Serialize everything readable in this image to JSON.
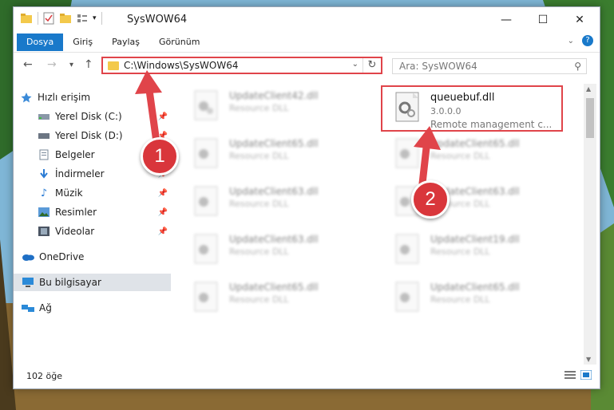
{
  "window": {
    "title": "SysWOW64",
    "controls": {
      "minimize": "—",
      "maximize": "☐",
      "close": "✕"
    }
  },
  "ribbon": {
    "tabs": [
      "Dosya",
      "Giriş",
      "Paylaş",
      "Görünüm"
    ],
    "help_label": "?"
  },
  "nav": {
    "back": "←",
    "forward": "→",
    "recent": "▾",
    "up": "↑",
    "address_path": "C:\\Windows\\SysWOW64",
    "address_dropdown": "⌄",
    "refresh": "↻",
    "search_placeholder": "Ara: SysWOW64"
  },
  "sidebar": {
    "items": [
      {
        "label": "Hızlı erişim",
        "icon": "star-icon",
        "pinned": false
      },
      {
        "label": "Yerel Disk (C:)",
        "icon": "drive-icon",
        "pinned": true
      },
      {
        "label": "Yerel Disk (D:)",
        "icon": "drive-icon",
        "pinned": true
      },
      {
        "label": "Belgeler",
        "icon": "documents-icon",
        "pinned": false
      },
      {
        "label": "İndirmeler",
        "icon": "download-icon",
        "pinned": true
      },
      {
        "label": "Müzik",
        "icon": "music-icon",
        "pinned": true
      },
      {
        "label": "Resimler",
        "icon": "pictures-icon",
        "pinned": true
      },
      {
        "label": "Videolar",
        "icon": "videos-icon",
        "pinned": true
      },
      {
        "label": "OneDrive",
        "icon": "cloud-icon",
        "pinned": false
      },
      {
        "label": "Bu bilgisayar",
        "icon": "computer-icon",
        "pinned": false,
        "selected": true
      },
      {
        "label": "Ağ",
        "icon": "network-icon",
        "pinned": false
      }
    ]
  },
  "files": [
    {
      "name": "UpdateClient42.dll",
      "desc": "Resource DLL",
      "blurred": true
    },
    {
      "name": "queuebuf.dll",
      "version": "3.0.0.0",
      "desc": "Remote management c...",
      "blurred": false
    },
    {
      "name": "UpdateClient65.dll",
      "desc": "Resource DLL",
      "blurred": true
    },
    {
      "name": "UpdateClient65.dll",
      "desc": "Resource DLL",
      "blurred": true
    },
    {
      "name": "UpdateClient63.dll",
      "desc": "Resource DLL",
      "blurred": true
    },
    {
      "name": "UpdateClient63.dll",
      "desc": "Resource DLL",
      "blurred": true
    },
    {
      "name": "UpdateClient63.dll",
      "desc": "Resource DLL",
      "blurred": true
    },
    {
      "name": "UpdateClient19.dll",
      "desc": "Resource DLL",
      "blurred": true
    },
    {
      "name": "UpdateClient65.dll",
      "desc": "Resource DLL",
      "blurred": true
    },
    {
      "name": "UpdateClient65.dll",
      "desc": "Resource DLL",
      "blurred": true
    }
  ],
  "status": {
    "item_count": "102 öğe"
  },
  "annotations": {
    "badge1": "1",
    "badge2": "2",
    "color": "#d9363b"
  },
  "colors": {
    "accent": "#1979ca",
    "highlight": "#e0444a"
  }
}
